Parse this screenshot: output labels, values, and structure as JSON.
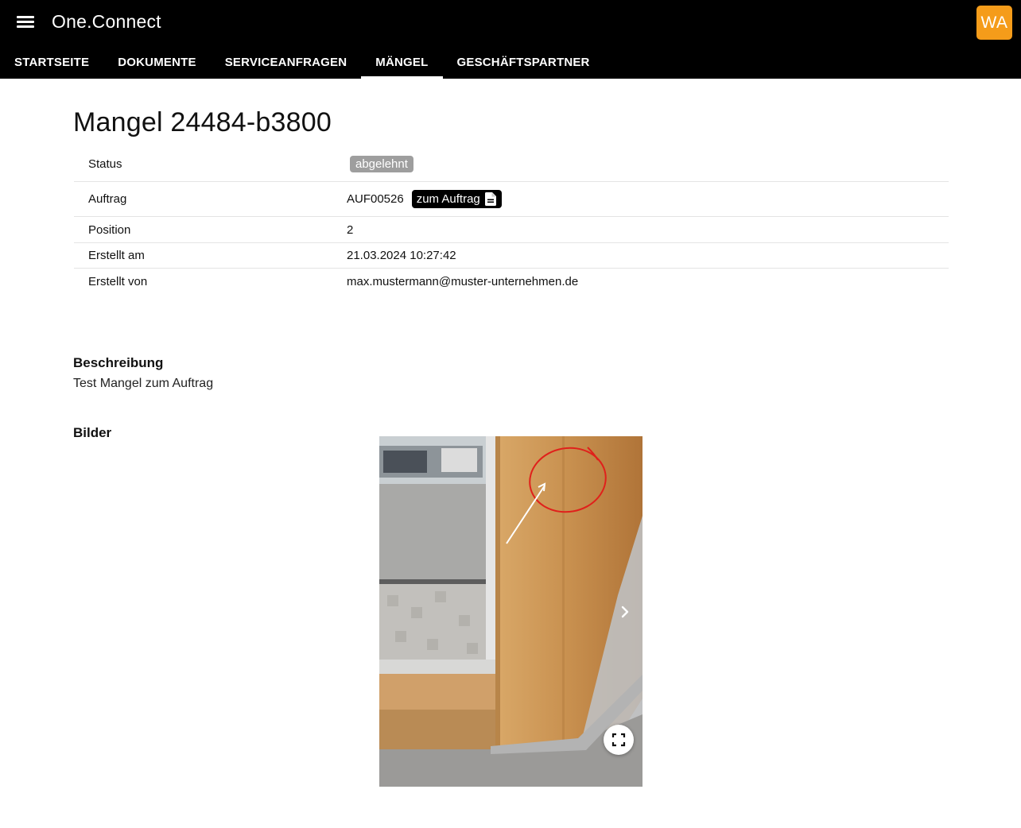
{
  "header": {
    "app_title": "One.Connect",
    "avatar_initials": "WA",
    "avatar_color": "#f59c1a",
    "menu_icon": "hamburger-menu-icon"
  },
  "nav": {
    "tabs": [
      {
        "label": "STARTSEITE",
        "active": false
      },
      {
        "label": "DOKUMENTE",
        "active": false
      },
      {
        "label": "SERVICEANFRAGEN",
        "active": false
      },
      {
        "label": "MÄNGEL",
        "active": true
      },
      {
        "label": "GESCHÄFTSPARTNER",
        "active": false
      }
    ]
  },
  "page": {
    "title": "Mangel 24484-b3800"
  },
  "details": {
    "status_label": "Status",
    "status_value": "abgelehnt",
    "order_label": "Auftrag",
    "order_value": "AUF00526",
    "order_button": "zum Auftrag",
    "position_label": "Position",
    "position_value": "2",
    "created_at_label": "Erstellt am",
    "created_at_value": "21.03.2024 10:27:42",
    "created_by_label": "Erstellt von",
    "created_by_value": "max.mustermann@muster-unternehmen.de"
  },
  "description": {
    "heading": "Beschreibung",
    "text": "Test Mangel zum Auftrag"
  },
  "images": {
    "heading": "Bilder",
    "next_icon": "chevron-right-icon",
    "fullscreen_icon": "fullscreen-icon"
  }
}
